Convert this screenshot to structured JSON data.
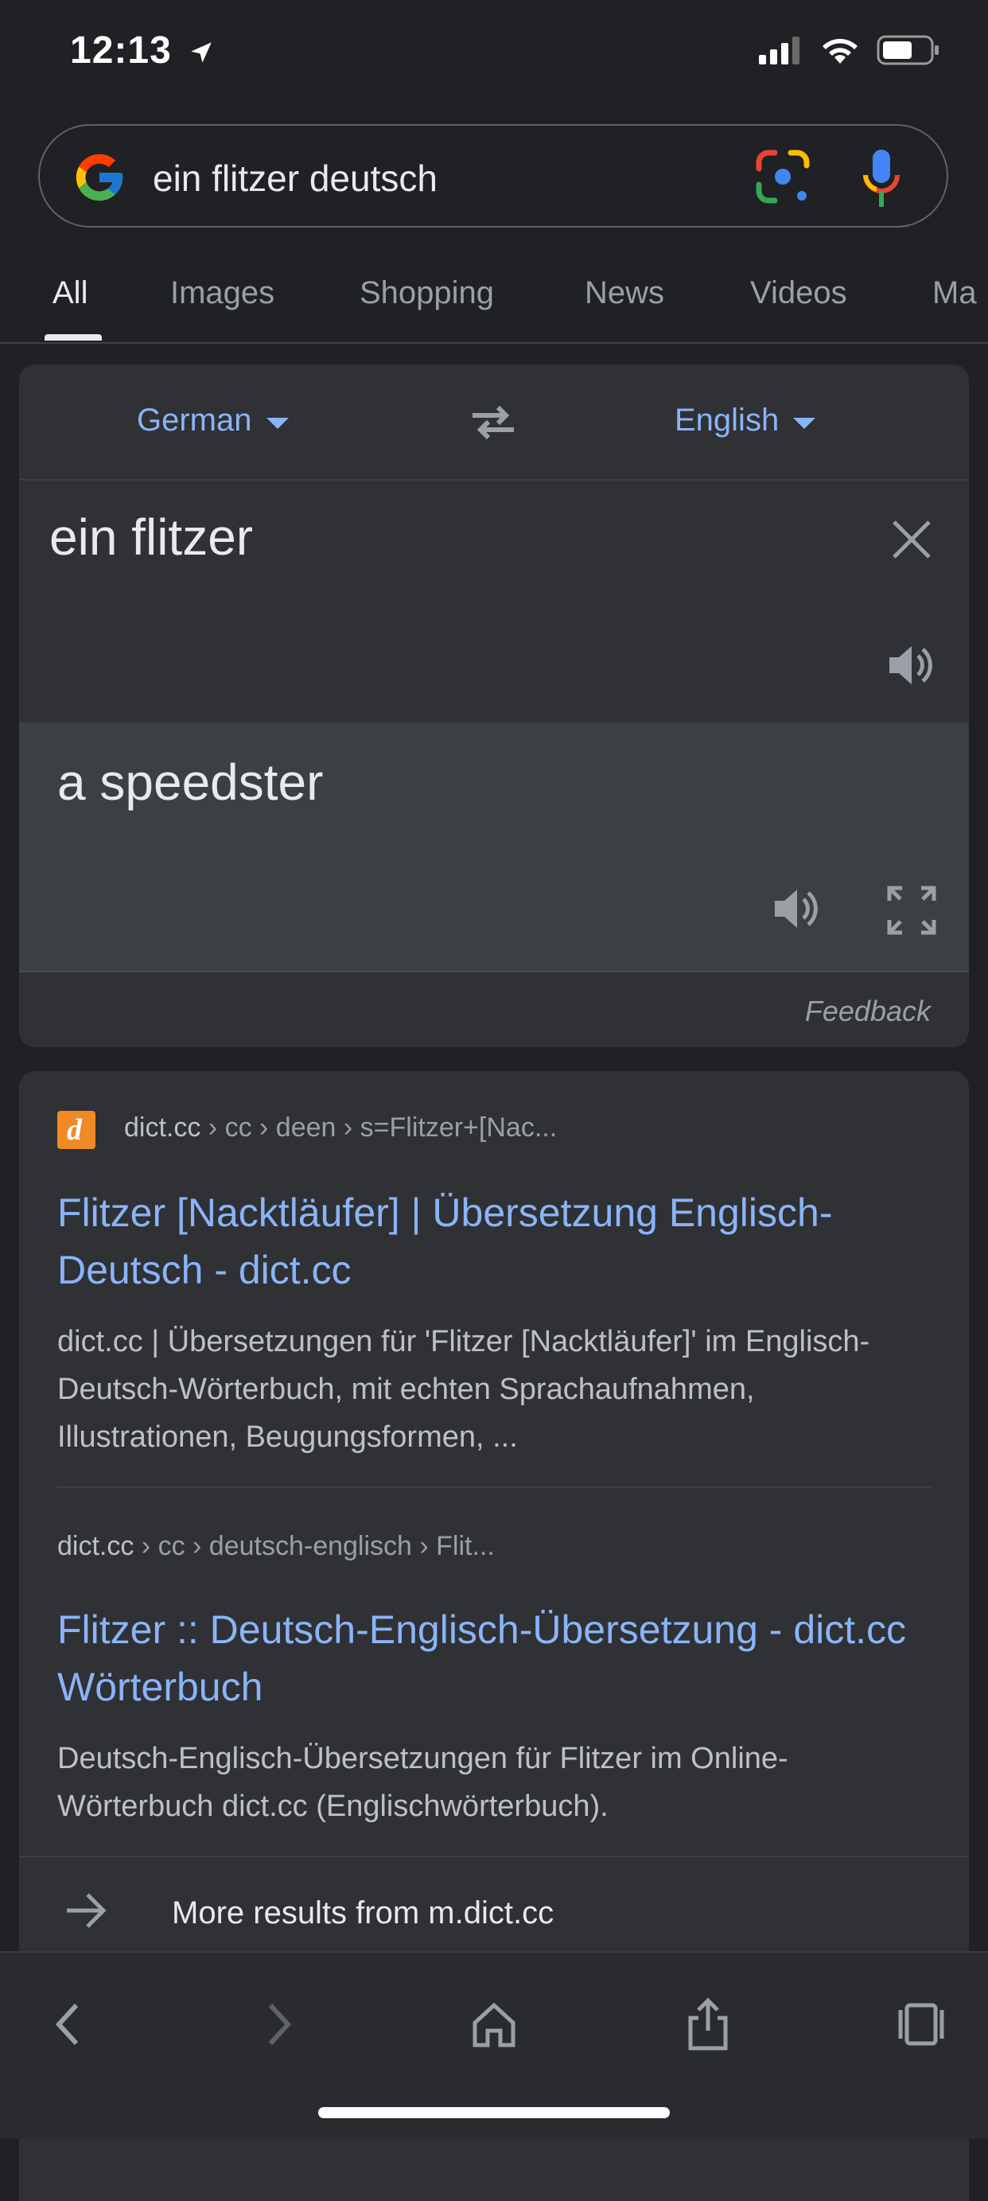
{
  "status_bar": {
    "time": "12:13"
  },
  "search": {
    "query": "ein flitzer deutsch"
  },
  "tabs": [
    {
      "label": "All",
      "active": true
    },
    {
      "label": "Images"
    },
    {
      "label": "Shopping"
    },
    {
      "label": "News"
    },
    {
      "label": "Videos"
    },
    {
      "label": "Ma"
    }
  ],
  "translate": {
    "source_lang": "German",
    "target_lang": "English",
    "source_text": "ein flitzer",
    "target_text": "a speedster",
    "feedback_label": "Feedback"
  },
  "results": [
    {
      "favicon_letter": "d",
      "site": "dict.cc",
      "path": " › cc › deen › s=Flitzer+[Nac...",
      "title": "Flitzer [Nacktläufer] | Übersetzung Englisch-Deutsch - dict.cc",
      "snippet": "dict.cc | Übersetzungen für 'Flitzer [Nacktläufer]' im Englisch-Deutsch-Wörterbuch, mit echten Sprachaufnahmen, Illustrationen, Beugungsformen, ..."
    },
    {
      "site": "dict.cc",
      "path": " › cc › deutsch-englisch › Flit...",
      "title": "Flitzer :: Deutsch-Englisch-Übersetzung - dict.cc Wörterbuch",
      "snippet": "Deutsch-Englisch-Übersetzungen für Flitzer im Online-Wörterbuch dict.cc (Englischwörterbuch)."
    }
  ],
  "more_results": {
    "label": "More results from m.dict.cc"
  },
  "colors": {
    "link": "#8ab4f8",
    "background": "#202124",
    "card": "#303134"
  }
}
